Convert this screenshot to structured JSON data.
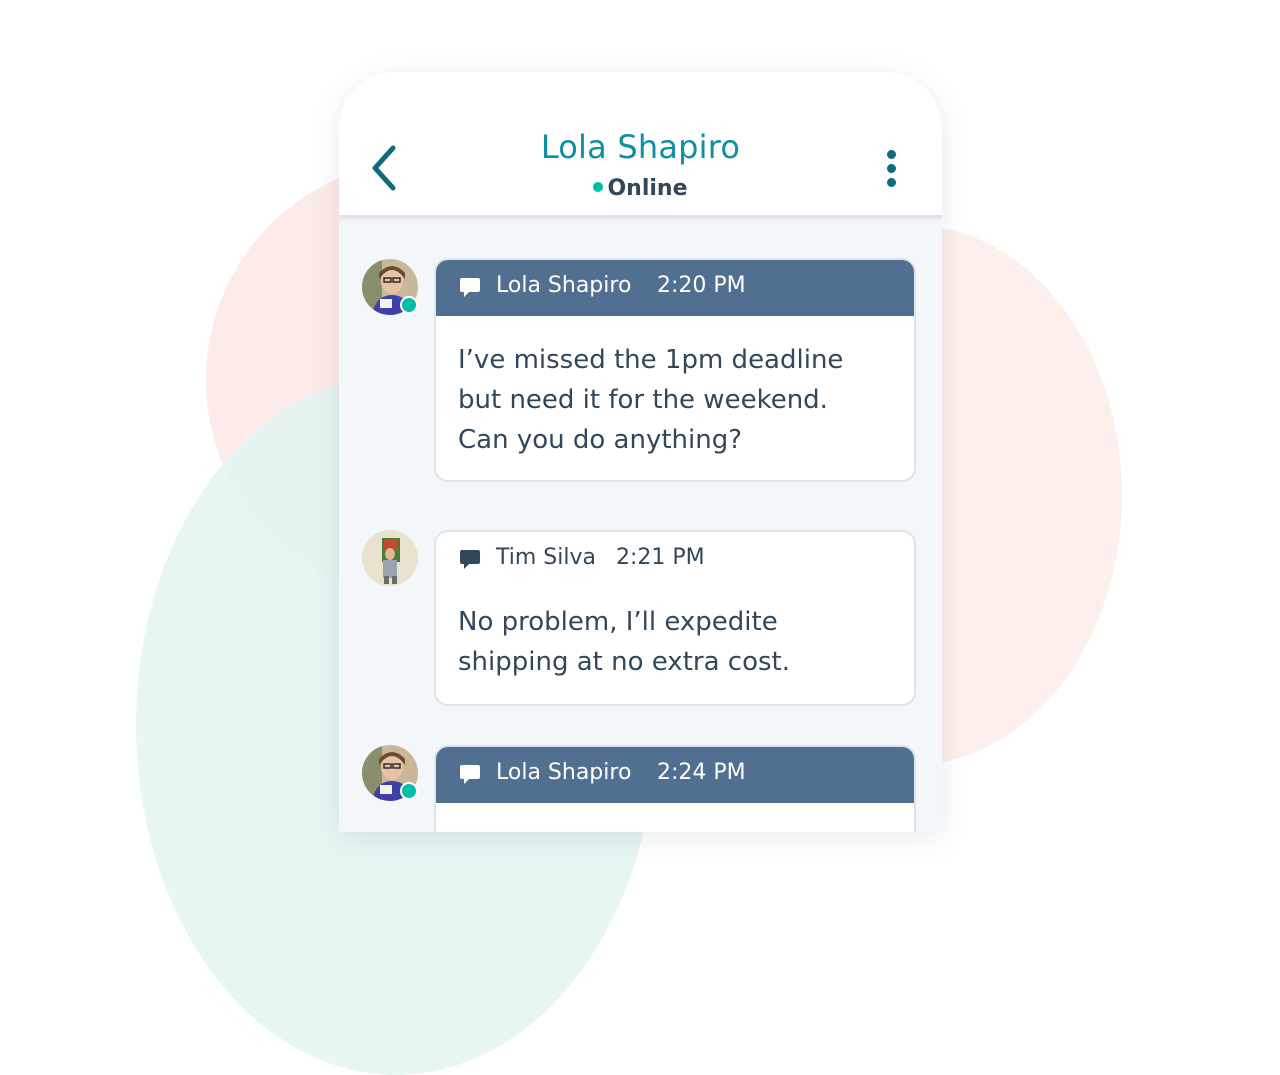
{
  "colors": {
    "accent": "#0f8ea5",
    "online": "#00bda5",
    "bubble_header_dark": "#516f90",
    "text": "#33475b"
  },
  "header": {
    "contact_name": "Lola Shapiro",
    "status": "Online",
    "back_icon": "chevron-left-icon",
    "menu_icon": "more-vertical-icon"
  },
  "messages": [
    {
      "sender": "Lola Shapiro",
      "time": "2:20 PM",
      "text": "I’ve missed the 1pm deadline\nbut need it for the weekend.\nCan you do anything?",
      "avatar": "lola-avatar",
      "online": true
    },
    {
      "sender": "Tim Silva",
      "time": "2:21 PM",
      "text": "No problem, I’ll expedite\nshipping at no extra cost.",
      "avatar": "tim-avatar",
      "online": false
    },
    {
      "sender": "Lola Shapiro",
      "time": "2:24 PM",
      "text": "",
      "avatar": "lola-avatar",
      "online": true
    }
  ]
}
